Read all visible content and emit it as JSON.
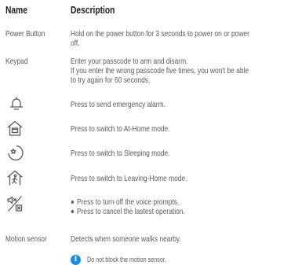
{
  "header": {
    "name": "Name",
    "description": "Description"
  },
  "rows": {
    "power_button": {
      "name": "Power Button",
      "lines": [
        "Hold on the power button for 3 seconds to power on or power",
        "off."
      ]
    },
    "keypad": {
      "name": "Keypad",
      "lines": [
        "Enter your passcode to arm and disarm.",
        "If you enter the wrong passcode five times, you won't be able",
        "to try again for 60 seconds."
      ]
    },
    "alarm": {
      "icon": "bell-icon",
      "text": "Press to send emergency alarm."
    },
    "home": {
      "icon": "home-mode-icon",
      "text": "Press to switch to At-Home mode."
    },
    "sleep": {
      "icon": "sleep-mode-icon",
      "text": "Press to switch to Sleeping mode."
    },
    "leave": {
      "icon": "leaving-home-icon",
      "text": "Press to switch to Leaving-Home mode."
    },
    "mute": {
      "icon": "mute-cancel-icon",
      "bullets": [
        "Press to turn off the voice prompts.",
        "Press to cancel the lastest operation."
      ]
    },
    "motion": {
      "name": "Motion sensor",
      "text": "Detects when someone walks nearby."
    }
  },
  "note": {
    "icon": "info-icon",
    "text": "Do not block the motion sensor."
  }
}
